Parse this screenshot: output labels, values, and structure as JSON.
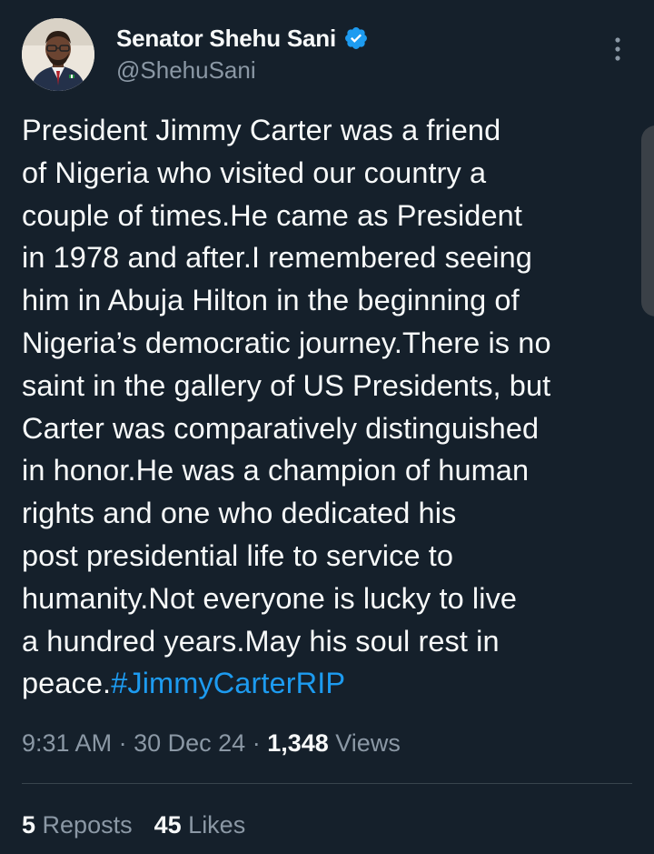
{
  "author": {
    "display_name": "Senator Shehu Sani",
    "handle": "@ShehuSani",
    "verified_icon": "verified-badge-icon",
    "avatar": "avatar"
  },
  "more_icon": "more-vertical-icon",
  "tweet": {
    "text": "President Jimmy Carter was a friend\nof Nigeria who visited our country a\ncouple of times.He came as President\nin 1978 and after.I remembered seeing\nhim in Abuja Hilton in the beginning of\nNigeria’s democratic journey.There is no\nsaint in the gallery of US Presidents, but\nCarter was comparatively distinguished\nin honor.He was a champion of human\nrights and one who dedicated his\npost presidential life to service to\nhumanity.Not everyone is lucky to live\na hundred years.May his soul rest in\npeace.",
    "hashtag": "#JimmyCarterRIP"
  },
  "meta": {
    "time": "9:31 AM",
    "date": "30 Dec 24",
    "views_count": "1,348",
    "views_label": "Views"
  },
  "stats": {
    "reposts_count": "5",
    "reposts_label": "Reposts",
    "likes_count": "45",
    "likes_label": "Likes"
  },
  "colors": {
    "background": "#15202b",
    "text": "#f7f9f9",
    "secondary": "#8b98a5",
    "accent": "#1d9bf0"
  }
}
